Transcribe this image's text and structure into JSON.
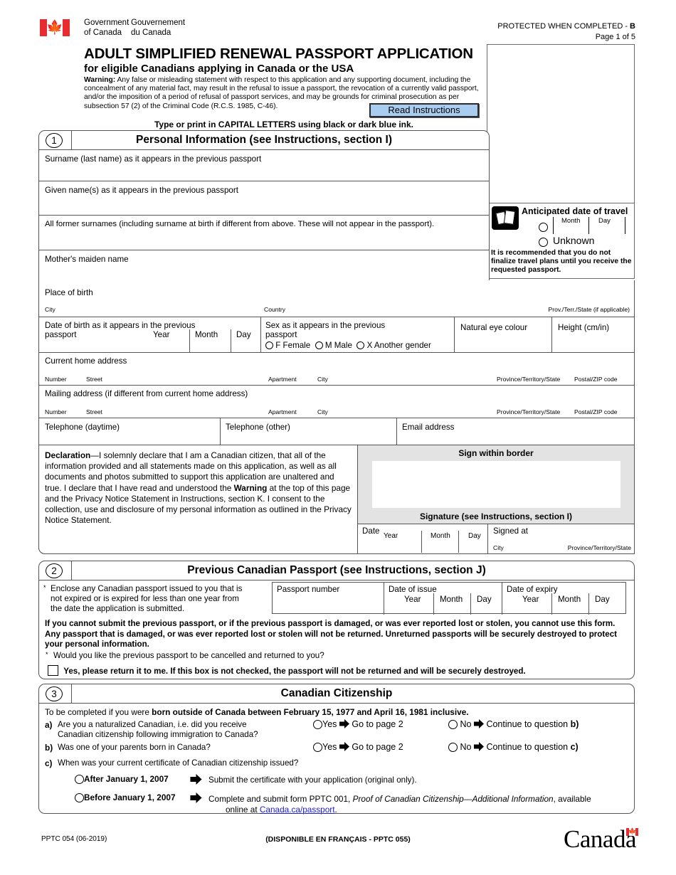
{
  "header": {
    "gov_en_line1": "Government",
    "gov_en_line2": "of Canada",
    "gov_fr_line1": "Gouvernement",
    "gov_fr_line2": "du Canada",
    "protected_label": "PROTECTED WHEN COMPLETED - ",
    "protected_class": "B",
    "page_label": "Page 1 of 5",
    "flag_icon": "canada-flag-icon"
  },
  "title": {
    "main": "ADULT SIMPLIFIED RENEWAL PASSPORT APPLICATION",
    "sub": "for eligible Canadians applying in Canada or the USA",
    "warning_label": "Warning:",
    "warning_text": " Any false or misleading statement with respect to this application and any supporting document, including the concealment of any material fact, may result in the refusal to issue a passport, the revocation of a currently valid passport, and/or the imposition of a period of refusal of passport services, and may be grounds for criminal prosecution as per subsection 57 (2) of the Criminal Code (R.C.S. 1985, C-46).",
    "read_instructions": "Read Instructions",
    "type_print": "Type or print in CAPITAL LETTERS using black or dark blue ink."
  },
  "travel": {
    "icon": "suitcase-icon",
    "heading": "Anticipated date of travel",
    "month": "Month",
    "day": "Day",
    "unknown": "Unknown",
    "note": "It is recommended that you do not finalize travel plans until you receive the requested passport."
  },
  "section1": {
    "number": "1",
    "heading": "Personal Information (see Instructions, section I)",
    "surname": "Surname (last name) as it appears in the previous passport",
    "given": "Given name(s) as it appears in the previous passport",
    "former": "All former surnames (including surname at birth if different from above. These will not appear in the passport).",
    "mother": "Mother's maiden name",
    "place_of_birth": "Place of birth",
    "city": "City",
    "country": "Country",
    "prov_state": "Prov./Terr./State (if applicable)",
    "dob_line1": "Date of birth as it appears in the previous",
    "dob_line2": "passport",
    "year": "Year",
    "month": "Month",
    "day": "Day",
    "sex_line1": "Sex as it appears in the previous",
    "sex_line2": "passport",
    "sex_f": "F  Female",
    "sex_m": "M  Male",
    "sex_x": "X  Another gender",
    "eye_colour": "Natural eye colour",
    "height": "Height  (cm/in)",
    "current_address": "Current home address",
    "mailing_address": "Mailing address (if different from current home address)",
    "addr_number": "Number",
    "addr_street": "Street",
    "addr_apartment": "Apartment",
    "addr_city": "City",
    "addr_prov": "Province/Territory/State",
    "addr_postal": "Postal/ZIP code",
    "tel_day": "Telephone (daytime)",
    "tel_other": "Telephone (other)",
    "email": "Email address",
    "decl_label": "Declaration",
    "decl_p1": "—I solemnly declare that I am a Canadian citizen, that all of the information provided and all statements made on this application, as well as all documents and photos submitted to support this application are unaltered and true. I declare that I have read and understood the ",
    "decl_warning": "Warning",
    "decl_p2": " at the top of this page and the Privacy Notice Statement in Instructions, section K. I consent to the collection, use and disclosure of my personal information as outlined in the Privacy Notice Statement.",
    "sign_within": "Sign within border",
    "signature_caption": "Signature (see Instructions, section I)",
    "date": "Date",
    "signed_at": "Signed at",
    "signed_city": "City",
    "signed_prov": "Province/Territory/State"
  },
  "section2": {
    "number": "2",
    "heading": "Previous Canadian Passport (see Instructions, section J)",
    "bullet": "*",
    "enclose_l1": "Enclose any Canadian passport issued to you that is",
    "enclose_l2": "not expired or is expired for less than one year from",
    "enclose_l3": "the date the application is submitted.",
    "passport_number": "Passport number",
    "date_of_issue": "Date of issue",
    "date_of_expiry": "Date of expiry",
    "year": "Year",
    "month": "Month",
    "day": "Day",
    "cannot_submit": "If you cannot submit the previous passport, or if the previous passport is damaged, or was ever reported lost or stolen, you cannot use this form. Any passport that is damaged, or was ever reported lost or stolen will not be returned. Unreturned passports will be securely destroyed to protect your personal information.",
    "would_you_like": "Would you like the previous passport to be cancelled and returned to you?",
    "yes_return": "Yes, please return it to me. If this box is not checked, the passport will not be returned and will be securely destroyed."
  },
  "section3": {
    "number": "3",
    "heading": "Canadian Citizenship",
    "intro_pre": "To be completed if you were ",
    "intro_bold": "born outside of Canada between February 15, 1977 and April 16, 1981 inclusive.",
    "qa_label": "a)",
    "qa_l1": "Are you a naturalized Canadian, i.e. did you receive",
    "qa_l2": "Canadian citizenship following immigration to Canada?",
    "qb_label": "b)",
    "qb_text": "Was one of your parents born in Canada?",
    "qc_label": "c)",
    "qc_text": "When was your current certificate of Canadian citizenship issued?",
    "yes": "Yes",
    "no": "No",
    "goto_page2": "Go to page 2",
    "continue_b": "Continue to question ",
    "continue_b_bold": "b)",
    "continue_c": "Continue to question ",
    "continue_c_bold": "c)",
    "after_2007": "After January 1, 2007",
    "before_2007": "Before January 1, 2007",
    "after_action": "Submit the certificate with your application (original only).",
    "before_action_p1": "Complete and submit form PPTC 001, ",
    "before_action_italic": "Proof of Canadian Citizenship—Additional Information",
    "before_action_p2": ", available",
    "before_action_p3": "online at ",
    "before_action_link": "Canada.ca/passport",
    "before_action_p4": "."
  },
  "footer": {
    "form_code": "PPTC 054 (06-2019)",
    "french_note": "(DISPONIBLE EN FRANÇAIS - PPTC 055)",
    "wordmark": "Canada",
    "wordmark_flag": "canada-flag-icon"
  },
  "colors": {
    "button_blue": "#a9cdf0",
    "flag_red": "#EA2A31",
    "link_blue": "#1a1ae6",
    "panel_grey": "#e3e3e3",
    "border_grey": "#555555"
  }
}
